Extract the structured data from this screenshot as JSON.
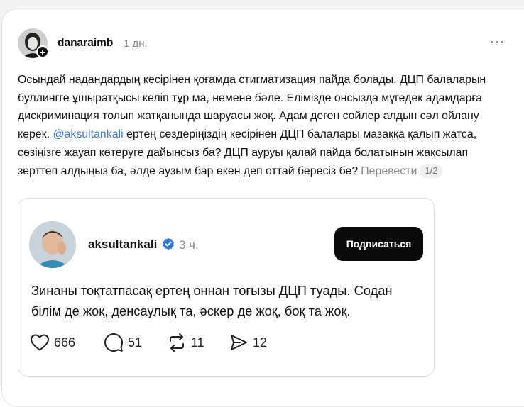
{
  "post": {
    "author": "danaraimb",
    "time": "1 дн.",
    "more": "···",
    "text_before_mention": "Осындай надандардың кесірінен қоғамда стигматизация пайда болады. ДЦП балаларын буллингге ұшыратқысы келіп тұр ма, немене бәле. Елімізде онсызда мүгедек адамдарға дискриминация толып жатқанында шаруасы жоқ. Адам деген сөйлер алдын сәл ойлану керек. ",
    "mention": "@aksultankali",
    "text_after_mention": " ертең сөздеріңіздің кесірінен ДЦП балалары мазаққа қалып жатса, сөзіңізге жауап көтеруге дайынсыз ба? ДЦП ауруы қалай пайда болатынын жақсылап зерттеп алдыңыз ба, әлде аузым бар екен деп оттай бересіз бе?",
    "translate": "Перевести",
    "pager": "1/2",
    "plus_badge": "+"
  },
  "quote": {
    "author": "aksultankali",
    "time": "3 ч.",
    "subscribe": "Подписаться",
    "text": "Зинаны тоқтатпасақ ертең оннан тоғызы ДЦП туады. Содан білім де жоқ, денсаулық та, әскер де жоқ, боқ та жоқ.",
    "likes": "666",
    "comments": "51",
    "reposts": "11",
    "shares": "12"
  },
  "colors": {
    "mention": "#4378d8",
    "verified": "#2e78e6",
    "button": "#0a0a0a"
  },
  "icons": [
    "plus-icon",
    "more-icon",
    "verified-icon",
    "heart-icon",
    "comment-icon",
    "repost-icon",
    "share-icon"
  ]
}
